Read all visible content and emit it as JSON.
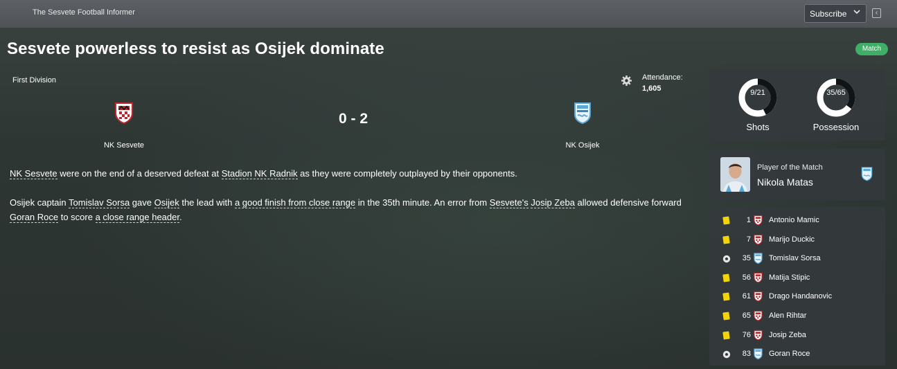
{
  "header": {
    "paper_name": "The Sesvete Football Informer",
    "subscribe_label": "Subscribe"
  },
  "article": {
    "headline": "Sesvete powerless to resist as Osijek dominate",
    "badge": "Match"
  },
  "match": {
    "competition": "First Division",
    "attendance_label": "Attendance:",
    "attendance_value": "1,605",
    "score": "0 - 2",
    "home_team": "NK Sesvete",
    "away_team": "NK Osijek"
  },
  "report": {
    "p1": [
      {
        "t": "NK Sesvete",
        "link": true
      },
      {
        "t": " were on the end of a deserved defeat at ",
        "link": false
      },
      {
        "t": "Stadion NK Radnik",
        "link": true
      },
      {
        "t": " as they were completely outplayed by their opponents.",
        "link": false
      }
    ],
    "p2": [
      {
        "t": "Osijek captain ",
        "link": false
      },
      {
        "t": "Tomislav Sorsa",
        "link": true
      },
      {
        "t": " gave ",
        "link": false
      },
      {
        "t": "Osijek",
        "link": true
      },
      {
        "t": " the lead with ",
        "link": false
      },
      {
        "t": "a good finish from close range",
        "link": true
      },
      {
        "t": " in the 35th minute. An error from ",
        "link": false
      },
      {
        "t": "Sesvete's",
        "link": true
      },
      {
        "t": " ",
        "link": false
      },
      {
        "t": "Josip Zeba",
        "link": true
      },
      {
        "t": " allowed defensive forward ",
        "link": false
      },
      {
        "t": "Goran Roce",
        "link": true
      },
      {
        "t": " to score ",
        "link": false
      },
      {
        "t": "a close range header",
        "link": true
      },
      {
        "t": ".",
        "link": false
      }
    ]
  },
  "stats": {
    "shots_label": "Shots",
    "shots_value": "9/21",
    "shots_fraction": 0.4286,
    "possession_label": "Possession",
    "possession_value": "35/65",
    "possession_fraction": 0.35
  },
  "player_of_match": {
    "label": "Player of the Match",
    "name": "Nikola Matas",
    "team": "osijek"
  },
  "events": [
    {
      "type": "yellow-card",
      "minute": "1",
      "team": "sesvete",
      "player": "Antonio Mamic"
    },
    {
      "type": "yellow-card",
      "minute": "7",
      "team": "sesvete",
      "player": "Marijo Duckic"
    },
    {
      "type": "goal",
      "minute": "35",
      "team": "osijek",
      "player": "Tomislav Sorsa"
    },
    {
      "type": "yellow-card",
      "minute": "56",
      "team": "sesvete",
      "player": "Matija Stipic"
    },
    {
      "type": "yellow-card",
      "minute": "61",
      "team": "sesvete",
      "player": "Drago Handanovic"
    },
    {
      "type": "yellow-card",
      "minute": "65",
      "team": "sesvete",
      "player": "Alen Rihtar"
    },
    {
      "type": "yellow-card",
      "minute": "76",
      "team": "sesvete",
      "player": "Josip Zeba"
    },
    {
      "type": "goal",
      "minute": "83",
      "team": "osijek",
      "player": "Goran Roce"
    }
  ],
  "colors": {
    "accent_green": "#3fae66",
    "yellow_card": "#f2d40b",
    "sesvete_red": "#c0262c",
    "osijek_blue": "#5aa9d6"
  }
}
